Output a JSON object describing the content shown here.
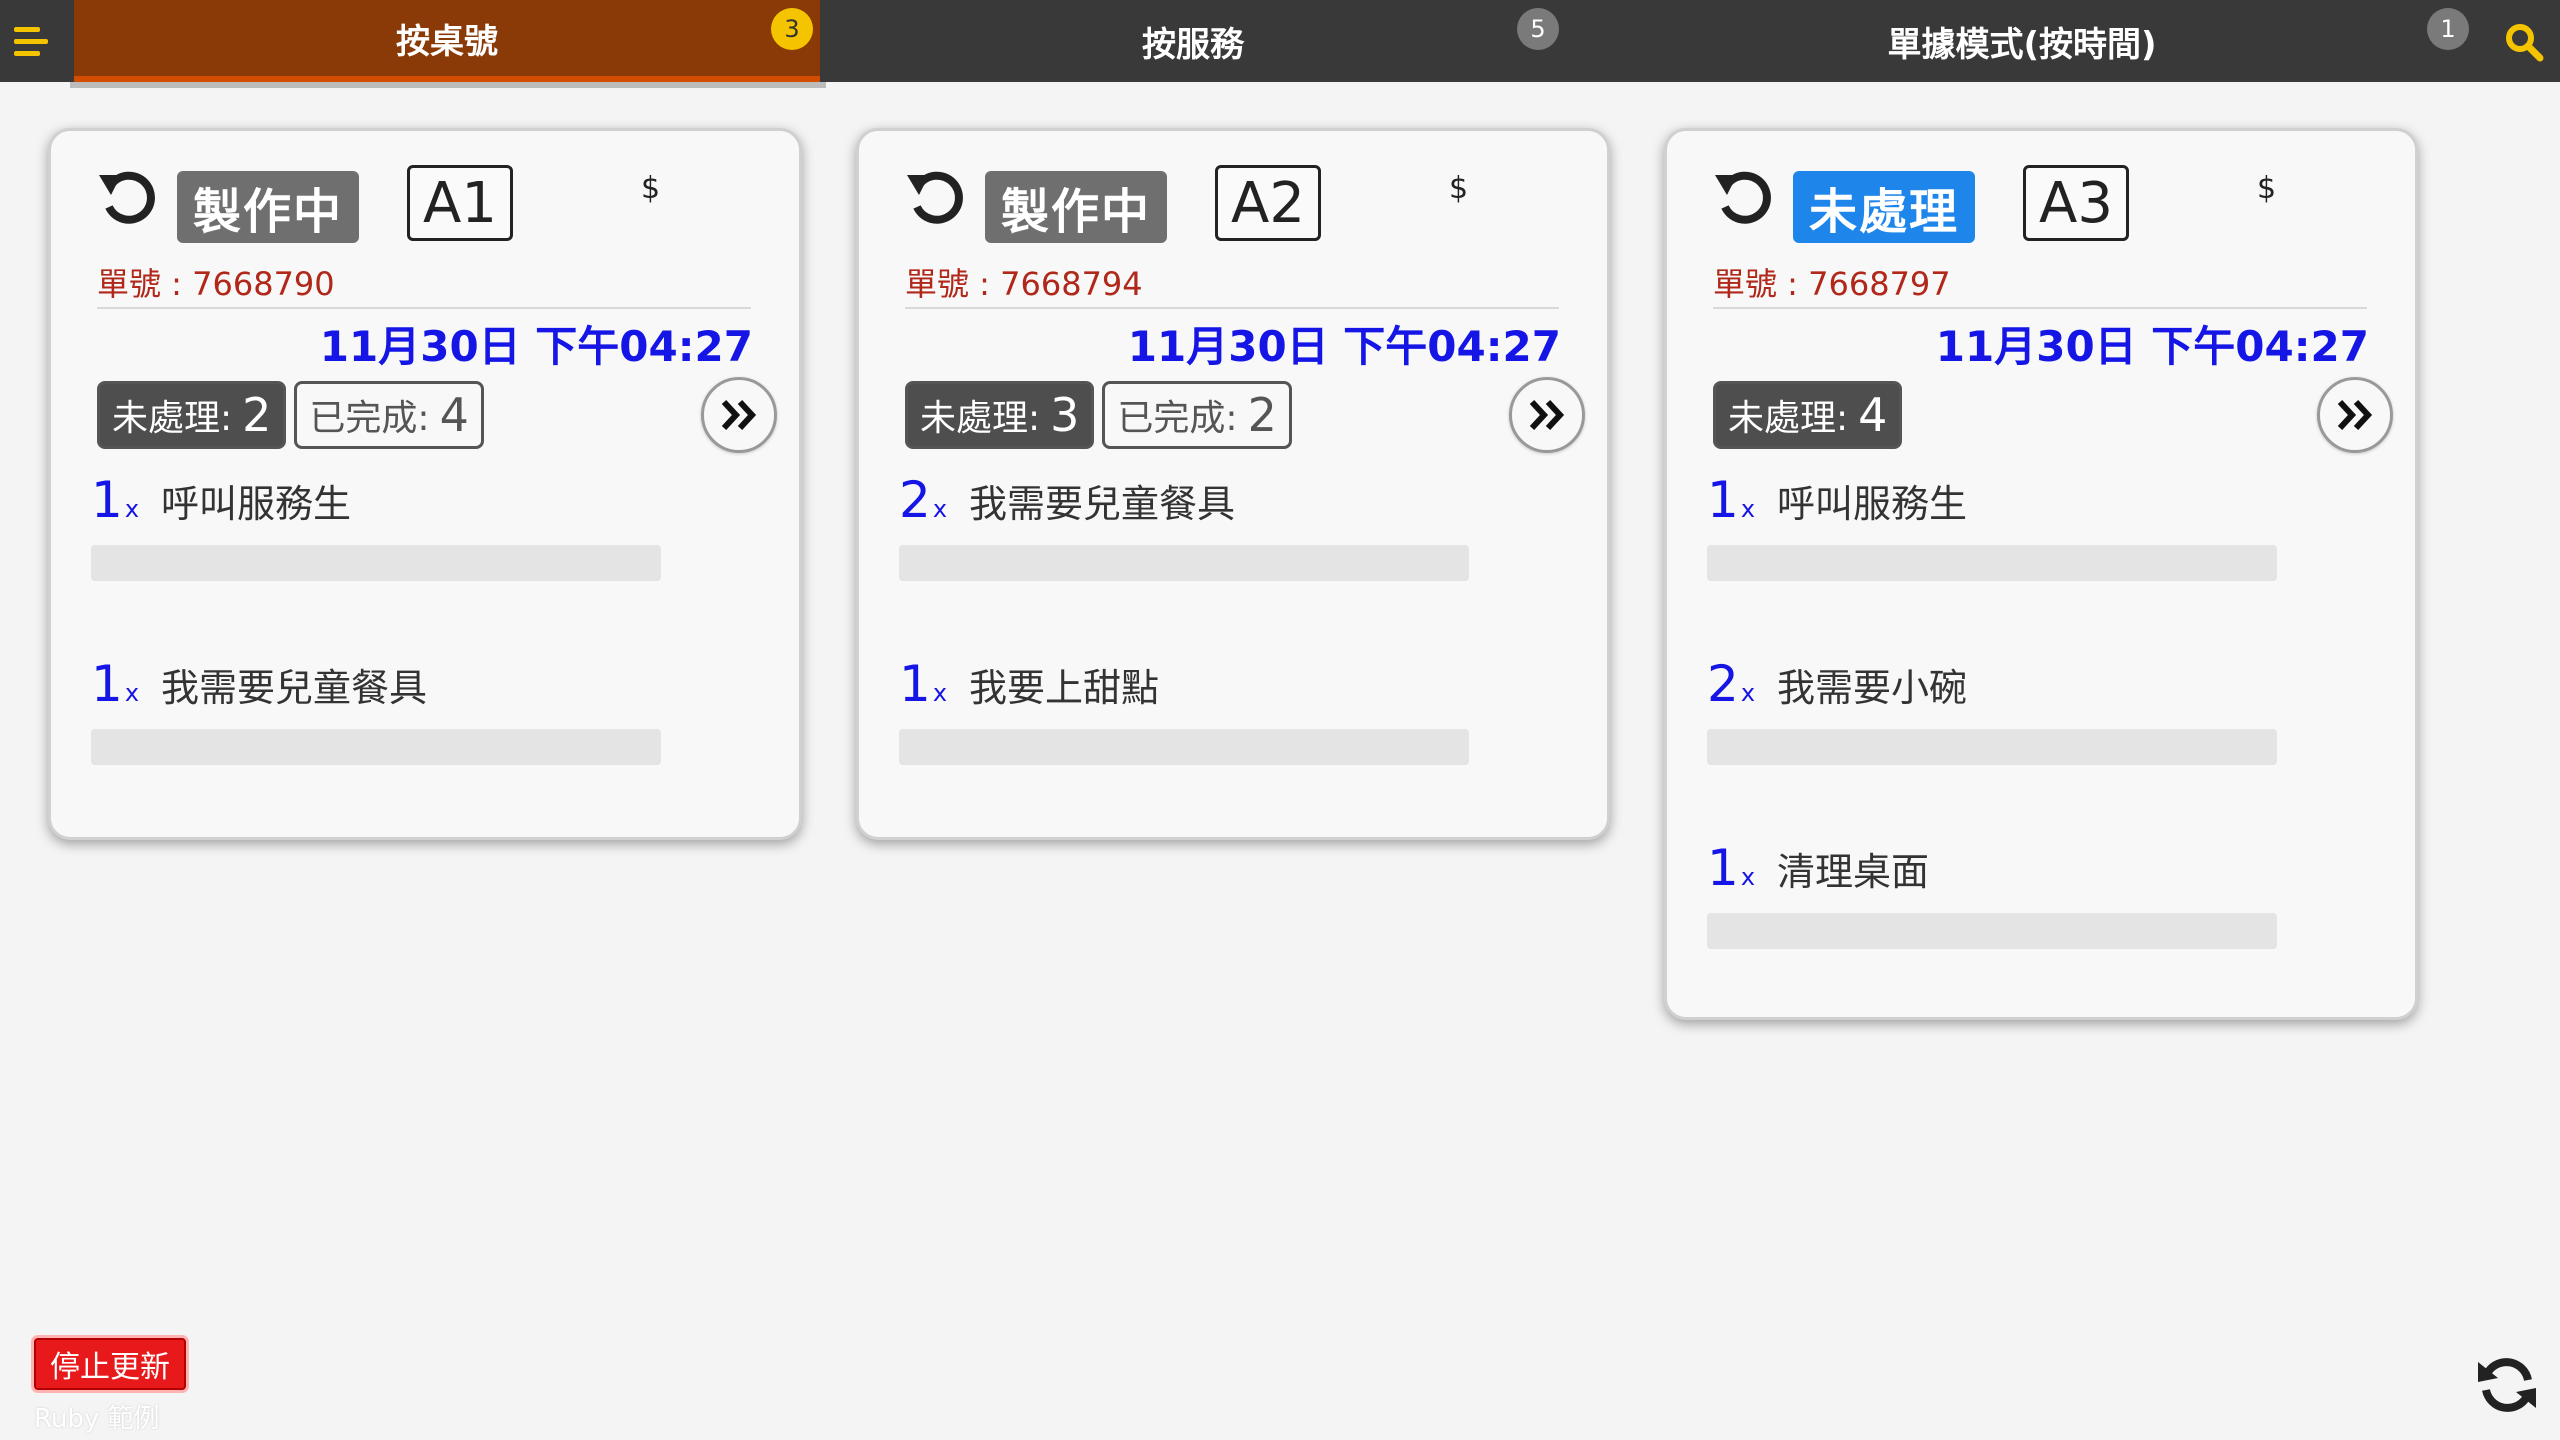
{
  "colors": {
    "topbar": "#393939",
    "active_tab": "#8a3a06",
    "accent_yellow": "#f5c400",
    "status_making": "#6f6f6f",
    "status_pending": "#1e86ea",
    "order_no_red": "#b0281a",
    "date_blue": "#1515e6",
    "stop_button_red": "#e8191b"
  },
  "icons": {
    "menu": "hamburger-icon",
    "search": "search-icon",
    "undo": "undo-icon",
    "next": "double-chevron-right-icon",
    "refresh": "refresh-icon"
  },
  "tabs": [
    {
      "label": "按桌號",
      "badge": "3",
      "active": true
    },
    {
      "label": "按服務",
      "badge": "5",
      "active": false
    },
    {
      "label": "單據模式(按時間)",
      "badge": "1",
      "active": false
    }
  ],
  "cards": [
    {
      "status": "製作中",
      "table": "A1",
      "price": "$",
      "order_no": "單號 : 7668790",
      "datetime": "11月30日 下午04:27",
      "pending_label": "未處理:",
      "pending_count": "2",
      "done_label": "已完成:",
      "done_count": "4",
      "items": [
        {
          "qty": "1",
          "x": "x",
          "name": "呼叫服務生"
        },
        {
          "qty": "1",
          "x": "x",
          "name": "我需要兒童餐具"
        }
      ]
    },
    {
      "status": "製作中",
      "table": "A2",
      "price": "$",
      "order_no": "單號 : 7668794",
      "datetime": "11月30日 下午04:27",
      "pending_label": "未處理:",
      "pending_count": "3",
      "done_label": "已完成:",
      "done_count": "2",
      "items": [
        {
          "qty": "2",
          "x": "x",
          "name": "我需要兒童餐具"
        },
        {
          "qty": "1",
          "x": "x",
          "name": "我要上甜點"
        }
      ]
    },
    {
      "status": "未處理",
      "table": "A3",
      "price": "$",
      "order_no": "單號 : 7668797",
      "datetime": "11月30日 下午04:27",
      "pending_label": "未處理:",
      "pending_count": "4",
      "items": [
        {
          "qty": "1",
          "x": "x",
          "name": "呼叫服務生"
        },
        {
          "qty": "2",
          "x": "x",
          "name": "我需要小碗"
        },
        {
          "qty": "1",
          "x": "x",
          "name": "清理桌面"
        }
      ]
    }
  ],
  "footer": {
    "stop_label": "停止更新",
    "bottom_text": "Ruby 範例"
  }
}
